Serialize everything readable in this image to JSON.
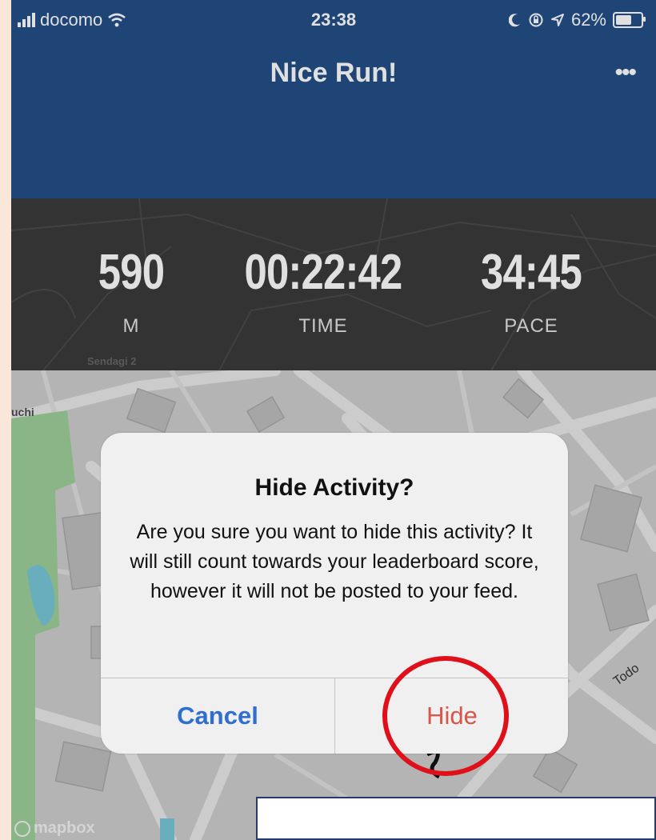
{
  "status_bar": {
    "carrier": "docomo",
    "time": "23:38",
    "battery": "62%",
    "battery_level": 0.62,
    "icons": [
      "signal-bars-icon",
      "wifi-icon",
      "moon-icon",
      "rotation-lock-icon",
      "location-arrow-icon",
      "battery-icon"
    ]
  },
  "header": {
    "title": "Nice Run!",
    "more_label": "•••"
  },
  "stats": [
    {
      "value": "590",
      "label": "M"
    },
    {
      "value": "00:22:42",
      "label": "TIME"
    },
    {
      "value": "34:45",
      "label": "PACE"
    }
  ],
  "map": {
    "labels": {
      "sendagi": "Sendagi 2",
      "uchi": "uchi",
      "todo": "Todo"
    },
    "attribution": "mapbox"
  },
  "alert": {
    "title": "Hide Activity?",
    "message": "Are you sure you want to hide this activity? It will still count towards your leaderboard score, however it will not be posted to your feed.",
    "cancel_label": "Cancel",
    "hide_label": "Hide"
  },
  "colors": {
    "header_bg": "#234f87",
    "stats_bg": "#3b3b3b",
    "cancel": "#2e6fd0",
    "hide": "#d9544a",
    "annotation": "#e0101a"
  }
}
